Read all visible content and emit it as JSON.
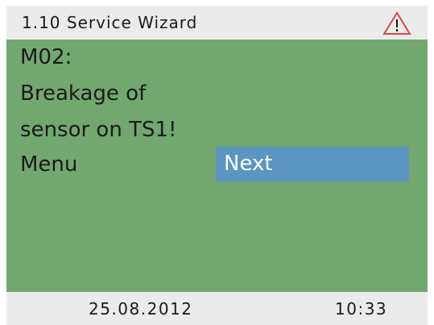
{
  "header": {
    "title": "1.10 Service Wizard",
    "icon": "warning-triangle-icon",
    "icon_color": "#e0454c"
  },
  "message": {
    "lines": [
      "M02:",
      "Breakage of",
      "sensor on TS1!"
    ]
  },
  "menu": {
    "label": "Menu",
    "selected_option": "Next",
    "selected_color": "#5b96c3"
  },
  "footer": {
    "date": "25.08.2012",
    "time": "10:33"
  },
  "colors": {
    "screen_background": "#72a86f",
    "bar_background": "#ebebeb"
  }
}
